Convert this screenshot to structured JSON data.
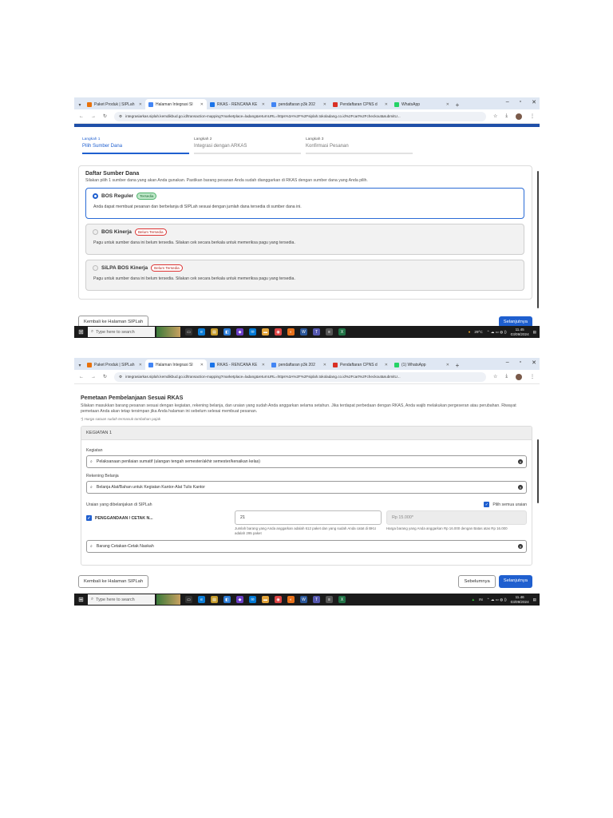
{
  "browser": {
    "tabs1": [
      {
        "label": "Paket Produk | SIPLah",
        "color": "#e8710a"
      },
      {
        "label": "Halaman Integrasi SI",
        "color": "#4285f4",
        "active": true
      },
      {
        "label": "RKAS - RENCANA KE",
        "color": "#1a73e8"
      },
      {
        "label": "pendaftaran p3k 202",
        "color": "#4285f4"
      },
      {
        "label": "Pendaftaran CPNS d",
        "color": "#d93025"
      },
      {
        "label": "WhatsApp",
        "color": "#25d366"
      }
    ],
    "tabs2": [
      {
        "label": "Paket Produk | SIPLah",
        "color": "#e8710a"
      },
      {
        "label": "Halaman Integrasi SI",
        "color": "#4285f4",
        "active": true
      },
      {
        "label": "RKAS - RENCANA KE",
        "color": "#1a73e8"
      },
      {
        "label": "pendaftaran p3k 202",
        "color": "#4285f4"
      },
      {
        "label": "Pendaftaran CPNS d",
        "color": "#d93025"
      },
      {
        "label": "(1) WhatsApp",
        "color": "#25d366"
      }
    ],
    "url": "integrasiarkas.siplah.kemdikbud.go.id/transaction-mapping?marketplace=ladang&returnURL=https%3A%2F%2Fsiplah.tokoladang.co.id%2Fcart%2Fcheckout&submitU..."
  },
  "screen1": {
    "steps": [
      {
        "num": "Langkah 1",
        "title": "Pilih Sumber Dana"
      },
      {
        "num": "Langkah 2",
        "title": "Integrasi dengan ARKAS"
      },
      {
        "num": "Langkah 3",
        "title": "Konfirmasi Pesanan"
      }
    ],
    "card_title": "Daftar Sumber Dana",
    "card_sub": "Silakan pilih 1 sumber dana yang akan Anda gunakan. Pastikan barang pesanan Anda sudah dianggarkan di RKAS dengan sumber dana yang Anda pilih.",
    "options": [
      {
        "name": "BOS Reguler",
        "badge": "Tersedia",
        "desc": "Anda dapat membuat pesanan dan berbelanja di SIPLah sesuai dengan jumlah dana tersedia di sumber dana ini."
      },
      {
        "name": "BOS Kinerja",
        "badge": "Belum Tersedia",
        "desc": "Pagu untuk sumber dana ini belum tersedia. Silakan cek secara berkala untuk memeriksa pagu yang tersedia."
      },
      {
        "name": "SiLPA BOS Kinerja",
        "badge": "Belum Tersedia",
        "desc": "Pagu untuk sumber dana ini belum tersedia. Silakan cek secara berkala untuk memeriksa pagu yang tersedia."
      }
    ],
    "back_button": "Kembali ke Halaman SIPLah",
    "next_button": "Selanjutnya"
  },
  "screen2": {
    "title": "Pemetaan Pembelanjaan Sesuai RKAS",
    "desc": "Silakan masukkan barang pesanan sesuai dengan kegiatan, rekening belanja, dan uraian yang sudah Anda anggarkan selama setahun. Jika terdapat perbedaan dengan RKAS, Anda wajib melakukan pergeseran atau perubahan. Riwayat pemetaan Anda akan tetap tersimpan jika Anda halaman ini sebelum selesai membuat pesanan.",
    "note": "*) Harga satuan sudah termasuk tambahan pajak",
    "kegiatan_header": "KEGIATAN 1",
    "kegiatan_label": "Kegiatan",
    "kegiatan_value": "Pelaksanaan penilaian sumatif (ulangan tengah semester/akhir semester/kenaikan kelas)",
    "rekening_label": "Rekening Belanja",
    "rekening_value": "Belanja Alat/Bahan untuk Kegiatan Kantor-Alat Tulis Kantor",
    "uraian_label": "Uraian yang dibelanjakan di SIPLah",
    "pilih_semua": "Pilih semua uraian",
    "item_name": "PENGGANDAAN / CETAK N...",
    "qty_value": "21",
    "qty_hint": "Jumlah barang yang Anda anggarkan adalah 612 paket dan yang sudah Anda catat di BKU adalah 295 paket",
    "price_placeholder": "Rp 15.000*",
    "price_hint": "Harga barang yang Anda anggarkan Rp 16.000 dengan Batas atas Rp 16.000",
    "barang_value": "Barang Cetakan-Cetak Naskah",
    "back_button": "Kembali ke Halaman SIPLah",
    "prev_button": "Sebelumnya",
    "next_button": "Selanjutnya"
  },
  "taskbar": {
    "search": "Type here to search",
    "weather1": "29°C",
    "time1": "11.45",
    "date1": "03/09/2024",
    "time2": "11.46",
    "date2": "03/09/2024",
    "lang": "IN"
  }
}
